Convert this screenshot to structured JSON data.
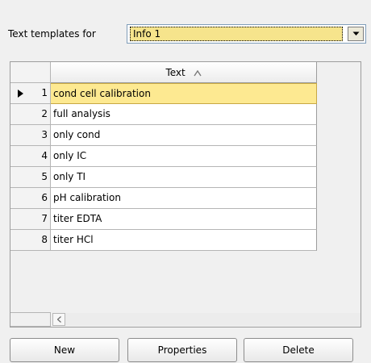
{
  "header": {
    "label": "Text templates for",
    "combo_value": "Info 1"
  },
  "grid": {
    "column_header": "Text",
    "rows": [
      {
        "num": "1",
        "text": "cond cell calibration",
        "selected": true
      },
      {
        "num": "2",
        "text": "full analysis"
      },
      {
        "num": "3",
        "text": "only cond"
      },
      {
        "num": "4",
        "text": "only IC"
      },
      {
        "num": "5",
        "text": "only TI"
      },
      {
        "num": "6",
        "text": "pH calibration"
      },
      {
        "num": "7",
        "text": "titer EDTA"
      },
      {
        "num": "8",
        "text": "titer HCl"
      }
    ],
    "sort_icon": "sort-ascending-icon",
    "current_row_icon": "row-pointer-icon"
  },
  "buttons": {
    "new_label": "New",
    "properties_label": "Properties",
    "delete_label": "Delete"
  },
  "colors": {
    "selection": "#fde991",
    "combo_highlight": "#f6e48c"
  }
}
